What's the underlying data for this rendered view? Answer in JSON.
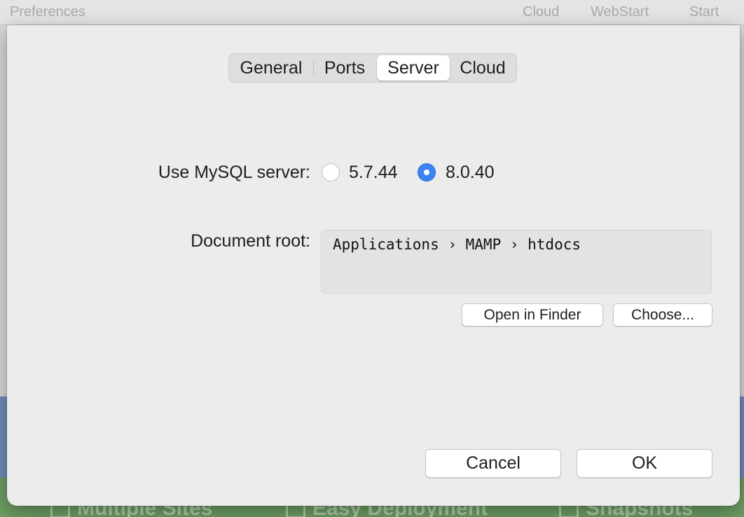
{
  "background_window": {
    "title": "Preferences",
    "toolbar": [
      "Cloud",
      "WebStart",
      "Start"
    ],
    "features": [
      "Multiple Sites",
      "Easy Deployment",
      "Snapshots"
    ]
  },
  "tabs": {
    "items": [
      {
        "label": "General",
        "selected": false
      },
      {
        "label": "Ports",
        "selected": false
      },
      {
        "label": "Server",
        "selected": true
      },
      {
        "label": "Cloud",
        "selected": false
      }
    ]
  },
  "mysql": {
    "label": "Use MySQL server:",
    "options": [
      {
        "label": "5.7.44",
        "selected": false
      },
      {
        "label": "8.0.40",
        "selected": true
      }
    ]
  },
  "document_root": {
    "label": "Document root:",
    "path": "Applications › MAMP › htdocs",
    "open_in_finder": "Open in Finder",
    "choose": "Choose..."
  },
  "footer": {
    "cancel": "Cancel",
    "ok": "OK"
  },
  "colors": {
    "accent": "#3b82f6",
    "sheet_background": "#ececec"
  }
}
